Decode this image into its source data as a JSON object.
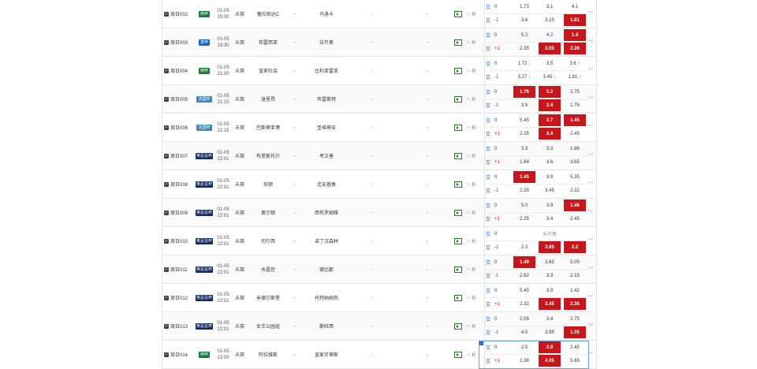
{
  "colors": {
    "accent": "#1a63c4",
    "highlight": "#c8161d",
    "up": "#d11111",
    "down": "#1a9a1a"
  },
  "labels": {
    "trade": "交",
    "analysis": "析",
    "expand": "﹀",
    "dash": "-"
  },
  "matches": [
    {
      "num": "周日002",
      "league": "西甲",
      "league_color": "#1a7a3a",
      "date": "01-05",
      "time": "19:00",
      "status": "未赛",
      "home": "塞拉帕达C",
      "away": "马洛卡",
      "odds": [
        {
          "h": "0",
          "v": [
            "1.73",
            "3.1",
            "4.1"
          ],
          "hi": []
        },
        {
          "h": "-1",
          "v": [
            "3.6",
            "3.15",
            "1.81"
          ],
          "hi": [
            2
          ]
        }
      ]
    },
    {
      "num": "周日003",
      "league": "意甲",
      "league_color": "#1a63c4",
      "date": "01-05",
      "time": "19:30",
      "status": "未赛",
      "home": "布雷西亚",
      "away": "拉齐奥",
      "odds": [
        {
          "h": "0",
          "v": [
            "5.2",
            "4.2",
            "1.4"
          ],
          "hi": [
            2
          ]
        },
        {
          "h": "+1",
          "v": [
            "2.35",
            "3.55",
            "2.26"
          ],
          "hi": [
            1,
            2
          ]
        }
      ]
    },
    {
      "num": "周日004",
      "league": "西甲",
      "league_color": "#1a7a3a",
      "date": "01-05",
      "time": "21:00",
      "status": "未赛",
      "home": "皇家社会",
      "away": "比利亚雷亚",
      "odds": [
        {
          "h": "0",
          "v": [
            "1.72",
            "3.5",
            "3.6"
          ],
          "hi": [],
          "arrows": [
            "dn",
            "",
            "up"
          ]
        },
        {
          "h": "-1",
          "v": [
            "3.27",
            "3.45",
            "1.81"
          ],
          "hi": [],
          "arrows": [
            "dn",
            "dn",
            "up"
          ]
        }
      ]
    },
    {
      "num": "周日005",
      "league": "法国杯",
      "league_color": "#3b8ab8",
      "date": "01-05",
      "time": "21:15",
      "status": "未赛",
      "home": "洛里昂",
      "away": "布雷斯特",
      "odds": [
        {
          "h": "0",
          "v": [
            "1.76",
            "5.2",
            "3.75"
          ],
          "hi": [
            0,
            1
          ]
        },
        {
          "h": "-1",
          "v": [
            "3.5",
            "3.4",
            "1.76"
          ],
          "hi": [
            1
          ]
        }
      ]
    },
    {
      "num": "周日006",
      "league": "法国杯",
      "league_color": "#3b8ab8",
      "date": "01-05",
      "time": "21:15",
      "status": "未赛",
      "home": "巴斯蒂亚博",
      "away": "圣埃蒂安",
      "odds": [
        {
          "h": "0",
          "v": [
            "5.45",
            "3.7",
            "1.45"
          ],
          "hi": [
            1,
            2
          ]
        },
        {
          "h": "+1",
          "v": [
            "2.25",
            "3.4",
            "2.45"
          ],
          "hi": [
            1
          ]
        }
      ]
    },
    {
      "num": "周日007",
      "league": "英足总杯",
      "league_color": "#0e2a5c",
      "date": "01-05",
      "time": "22:01",
      "status": "未赛",
      "home": "布里斯托尔",
      "away": "考文垂",
      "odds": [
        {
          "h": "0",
          "v": [
            "3.3",
            "3.3",
            "1.86"
          ],
          "hi": []
        },
        {
          "h": "+1",
          "v": [
            "1.68",
            "3.6",
            "3.65"
          ],
          "hi": []
        }
      ]
    },
    {
      "num": "周日008",
      "league": "英足总杯",
      "league_color": "#0e2a5c",
      "date": "01-05",
      "time": "22:01",
      "status": "未赛",
      "home": "伯顿",
      "away": "北安普敦",
      "odds": [
        {
          "h": "0",
          "v": [
            "1.45",
            "3.9",
            "5.35"
          ],
          "hi": [
            0
          ]
        },
        {
          "h": "-1",
          "v": [
            "2.35",
            "3.45",
            "2.32"
          ],
          "hi": []
        }
      ]
    },
    {
      "num": "周日009",
      "league": "英足总杯",
      "league_color": "#0e2a5c",
      "date": "01-05",
      "time": "22:01",
      "status": "未赛",
      "home": "奥尔顿",
      "away": "西布罗姆维",
      "odds": [
        {
          "h": "0",
          "v": [
            "5.0",
            "3.9",
            "1.46"
          ],
          "hi": [
            2
          ]
        },
        {
          "h": "+1",
          "v": [
            "2.25",
            "3.4",
            "2.45"
          ],
          "hi": []
        }
      ]
    },
    {
      "num": "周日010",
      "league": "英足总杯",
      "league_color": "#0e2a5c",
      "date": "01-05",
      "time": "22:01",
      "status": "未赛",
      "home": "切尔西",
      "away": "诺丁汉森林",
      "odds": [
        {
          "h": "0",
          "v": [],
          "hi": [],
          "note": "未开售"
        },
        {
          "h": "-2",
          "v": [
            "2.3",
            "3.85",
            "2.2"
          ],
          "hi": [
            1,
            2
          ]
        }
      ]
    },
    {
      "num": "周日011",
      "league": "英足总杯",
      "league_color": "#0e2a5c",
      "date": "01-05",
      "time": "22:01",
      "status": "未赛",
      "home": "水晶宫",
      "away": "德比郡",
      "odds": [
        {
          "h": "0",
          "v": [
            "1.49",
            "3.65",
            "5.05"
          ],
          "hi": [
            0
          ]
        },
        {
          "h": "-1",
          "v": [
            "2.62",
            "3.3",
            "2.15"
          ],
          "hi": []
        }
      ]
    },
    {
      "num": "周日012",
      "league": "英足总杯",
      "league_color": "#0e2a5c",
      "date": "01-05",
      "time": "22:01",
      "status": "未赛",
      "home": "米德尔斯堡",
      "away": "托特纳姆热",
      "odds": [
        {
          "h": "0",
          "v": [
            "5.45",
            "3.9",
            "1.42"
          ],
          "hi": []
        },
        {
          "h": "+1",
          "v": [
            "2.32",
            "3.45",
            "2.35"
          ],
          "hi": [
            1,
            2
          ]
        }
      ]
    },
    {
      "num": "周日013",
      "league": "英足总杯",
      "league_color": "#0e2a5c",
      "date": "01-05",
      "time": "22:01",
      "status": "未赛",
      "home": "女王公园巡",
      "away": "斯旺西",
      "odds": [
        {
          "h": "0",
          "v": [
            "2.06",
            "3.4",
            "2.75"
          ],
          "hi": []
        },
        {
          "h": "-1",
          "v": [
            "4.0",
            "3.95",
            "1.55"
          ],
          "hi": [
            2
          ]
        }
      ]
    },
    {
      "num": "周日014",
      "league": "西甲",
      "league_color": "#1a7a3a",
      "date": "01-05",
      "time": "23:00",
      "status": "未赛",
      "home": "阿拉维斯",
      "away": "皇家贝蒂斯",
      "odds": [
        {
          "h": "0",
          "v": [
            "2.5",
            "3.0",
            "2.45"
          ],
          "hi": [
            1
          ]
        },
        {
          "h": "+1",
          "v": [
            "1.38",
            "4.05",
            "5.65"
          ],
          "hi": [
            1
          ]
        }
      ],
      "selected": true
    }
  ]
}
